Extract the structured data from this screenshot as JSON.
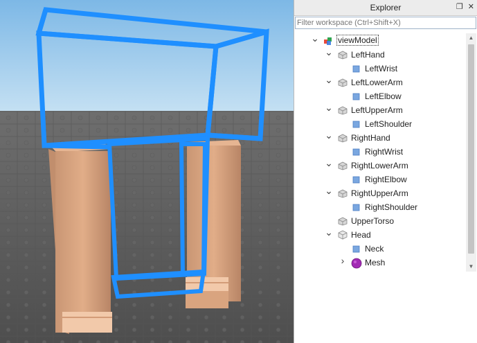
{
  "explorer": {
    "title": "Explorer",
    "restore_icon": "restore-window-icon",
    "close_icon": "close-icon",
    "filter_placeholder": "Filter workspace (Ctrl+Shift+X)",
    "tree": [
      {
        "label": "viewModel",
        "icon": "model-icon",
        "depth": 0,
        "arrow": "expanded",
        "selected": true
      },
      {
        "label": "LeftHand",
        "icon": "meshpart-icon",
        "depth": 1,
        "arrow": "expanded"
      },
      {
        "label": "LeftWrist",
        "icon": "attachment-icon",
        "depth": 2,
        "arrow": "none"
      },
      {
        "label": "LeftLowerArm",
        "icon": "meshpart-icon",
        "depth": 1,
        "arrow": "expanded"
      },
      {
        "label": "LeftElbow",
        "icon": "attachment-icon",
        "depth": 2,
        "arrow": "none"
      },
      {
        "label": "LeftUpperArm",
        "icon": "meshpart-icon",
        "depth": 1,
        "arrow": "expanded"
      },
      {
        "label": "LeftShoulder",
        "icon": "attachment-icon",
        "depth": 2,
        "arrow": "none"
      },
      {
        "label": "RightHand",
        "icon": "meshpart-icon",
        "depth": 1,
        "arrow": "expanded"
      },
      {
        "label": "RightWrist",
        "icon": "attachment-icon",
        "depth": 2,
        "arrow": "none"
      },
      {
        "label": "RightLowerArm",
        "icon": "meshpart-icon",
        "depth": 1,
        "arrow": "expanded"
      },
      {
        "label": "RightElbow",
        "icon": "attachment-icon",
        "depth": 2,
        "arrow": "none"
      },
      {
        "label": "RightUpperArm",
        "icon": "meshpart-icon",
        "depth": 1,
        "arrow": "expanded"
      },
      {
        "label": "RightShoulder",
        "icon": "attachment-icon",
        "depth": 2,
        "arrow": "none"
      },
      {
        "label": "UpperTorso",
        "icon": "meshpart-icon",
        "depth": 1,
        "arrow": "none"
      },
      {
        "label": "Head",
        "icon": "part-icon",
        "depth": 1,
        "arrow": "expanded"
      },
      {
        "label": "Neck",
        "icon": "attachment-icon",
        "depth": 2,
        "arrow": "none"
      },
      {
        "label": "Mesh",
        "icon": "specialmesh-icon",
        "depth": 2,
        "arrow": "collapsed"
      }
    ]
  },
  "viewport": {
    "sky_color": "#a6cde8",
    "baseplate_color": "#5f5f5f",
    "selection_color": "#1f8fff",
    "skin_color": "#d8a07a"
  }
}
